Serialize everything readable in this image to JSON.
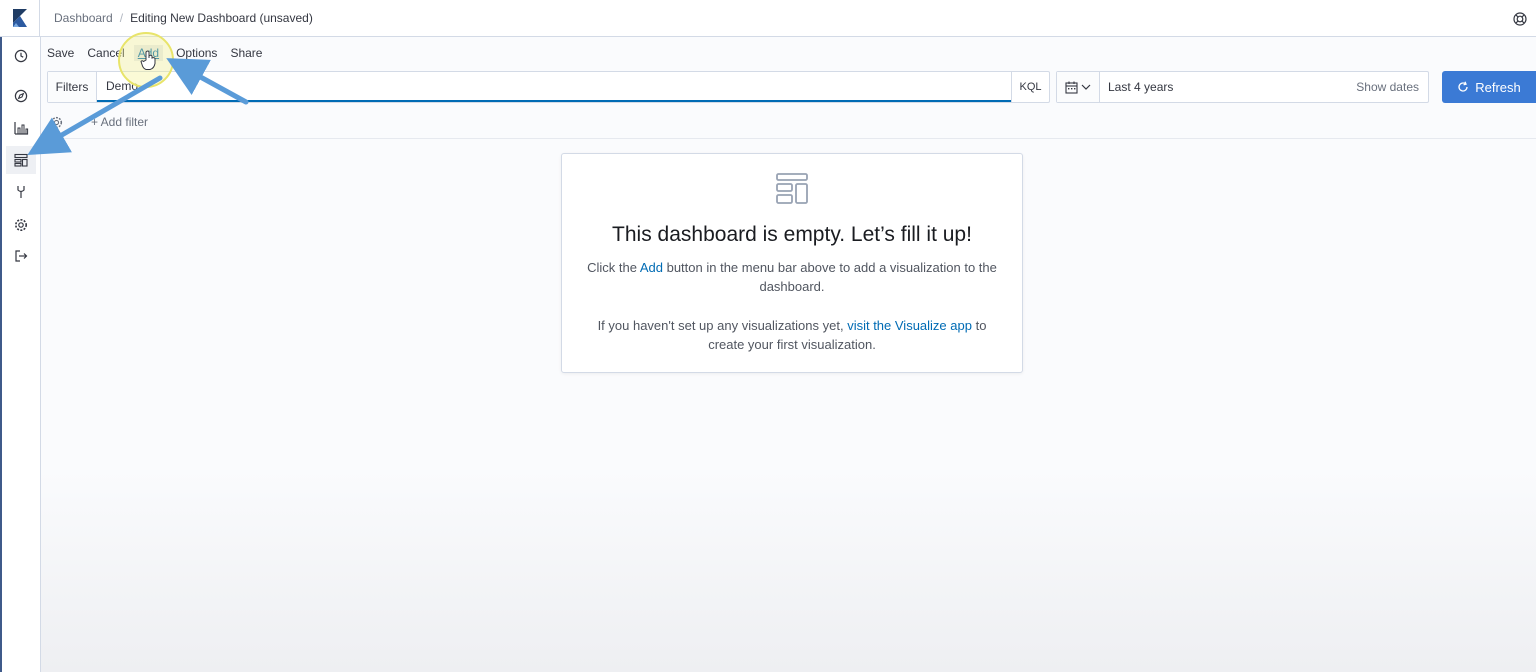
{
  "breadcrumb": {
    "root": "Dashboard",
    "separator": "/",
    "current": "Editing New Dashboard (unsaved)"
  },
  "menu": {
    "save": "Save",
    "cancel": "Cancel",
    "add": "Add",
    "options": "Options",
    "share": "Share"
  },
  "querybar": {
    "filters_label": "Filters",
    "query_value": "Demo",
    "language": "KQL"
  },
  "datepicker": {
    "range": "Last 4 years",
    "show_dates": "Show dates"
  },
  "refresh": {
    "label": "Refresh"
  },
  "filterbar": {
    "add_filter": "+ Add filter"
  },
  "empty": {
    "title": "This dashboard is empty. Let’s fill it up!",
    "p1_before": "Click the ",
    "p1_link": "Add",
    "p1_after": " button in the menu bar above to add a visualization to the dashboard.",
    "p2_before": "If you haven't set up any visualizations yet, ",
    "p2_link": "visit the Visualize app",
    "p2_after": " to create your first visualization."
  },
  "colors": {
    "accent": "#006bb4",
    "refresh_bg": "#3b7ad5",
    "annotation_arrow": "#5a9bd8",
    "annotation_highlight": "#f4f18a"
  },
  "icons": {
    "logo": "kibana-logo-icon",
    "help": "help-lifebuoy-icon",
    "nav": [
      "clock-icon",
      "compass-icon",
      "visualize-icon",
      "dashboard-icon",
      "dev-tools-icon",
      "gear-icon",
      "logout-icon"
    ]
  }
}
